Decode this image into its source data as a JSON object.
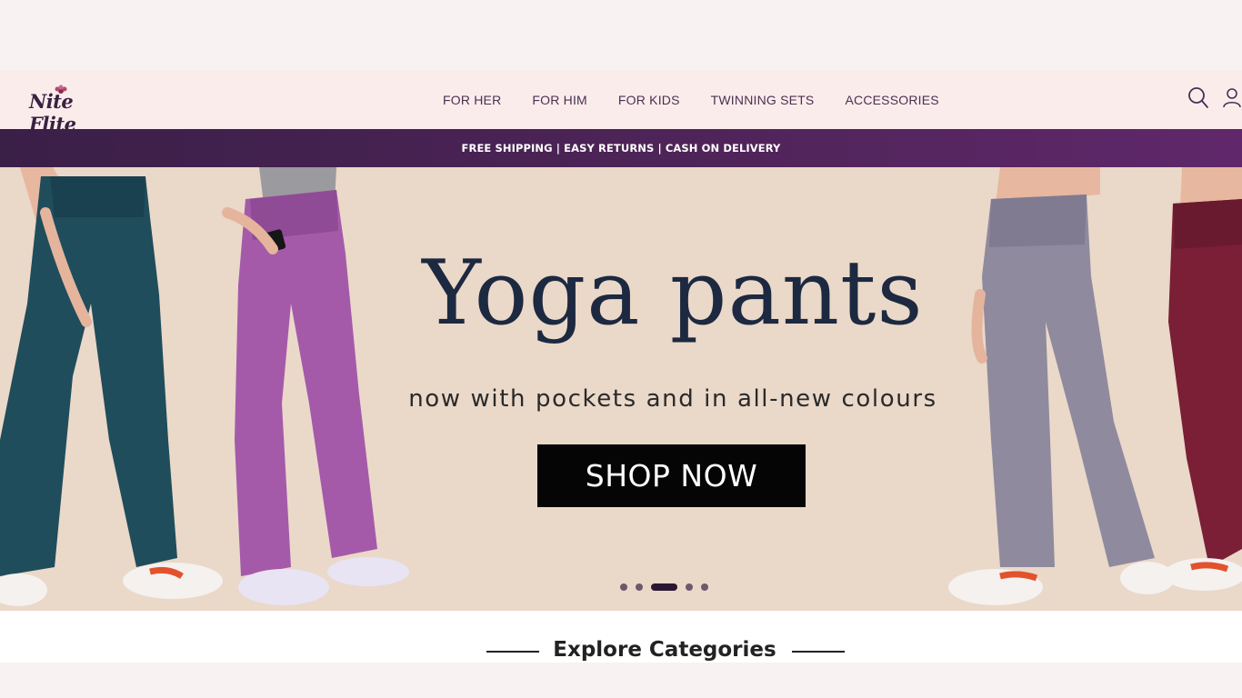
{
  "brand": {
    "logo_text": "Nite Flite"
  },
  "nav": {
    "items": [
      {
        "label": "FOR HER"
      },
      {
        "label": "FOR HIM"
      },
      {
        "label": "FOR KIDS"
      },
      {
        "label": "TWINNING SETS"
      },
      {
        "label": "ACCESSORIES"
      }
    ]
  },
  "header_icons": {
    "search": "search-icon",
    "account": "user-icon"
  },
  "promo": {
    "text": "FREE SHIPPING | EASY RETURNS | CASH ON DELIVERY"
  },
  "hero": {
    "headline": "Yoga pants",
    "subline": "now with pockets and in all-new colours",
    "cta": "SHOP NOW",
    "slides": {
      "count": 5,
      "active_index": 2
    },
    "colors": {
      "background": "#ead8c9",
      "teal": "#1f4d5c",
      "orchid": "#a45aa9",
      "grey": "#8f8a9e",
      "maroon": "#7a1f35"
    }
  },
  "categories": {
    "title": "Explore Categories"
  },
  "colors": {
    "promo_bar": "#4e2458",
    "header_bg": "#fbecec",
    "accent_text": "#4a3050"
  }
}
